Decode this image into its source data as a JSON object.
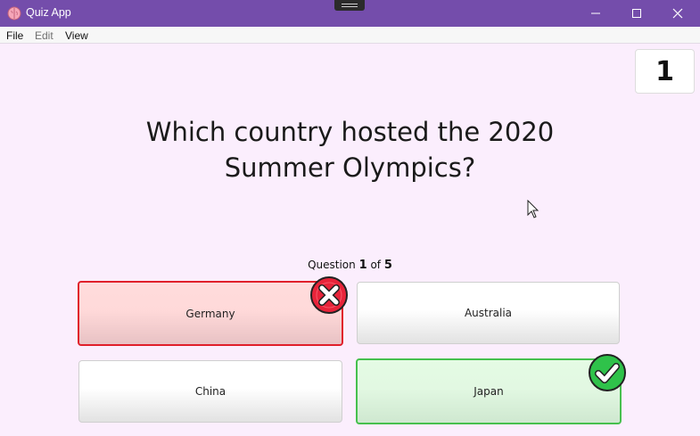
{
  "window": {
    "title": "Quiz App"
  },
  "menu": {
    "file": "File",
    "edit": "Edit",
    "view": "View"
  },
  "score": "1",
  "question": {
    "text": "Which country hosted the 2020 Summer Olympics?"
  },
  "counter": {
    "prefix": "Question",
    "current": "1",
    "of": "of",
    "total": "5"
  },
  "answers": [
    {
      "label": "Germany",
      "state": "wrong"
    },
    {
      "label": "Australia",
      "state": "neutral"
    },
    {
      "label": "China",
      "state": "neutral"
    },
    {
      "label": "Japan",
      "state": "correct"
    }
  ],
  "colors": {
    "titlebar": "#744dab",
    "background": "#fbeefd",
    "wrong": "#e0202b",
    "correct": "#46c04e"
  }
}
